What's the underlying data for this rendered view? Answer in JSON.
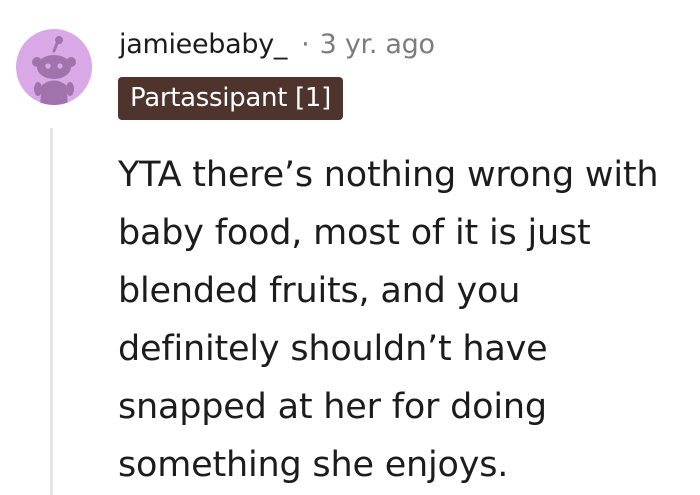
{
  "comment": {
    "avatar_icon": "reddit-snoo-avatar-icon",
    "avatar_bg_color": "#d9a8e6",
    "username": "jamieebaby_",
    "separator": "·",
    "timestamp": "3 yr. ago",
    "flair": {
      "label": "Partassipant [1]",
      "bg_color": "#4e342c",
      "text_color": "#ffffff"
    },
    "body_lines": [
      "YTA there’s nothing wrong with",
      "baby food, most of it is just",
      "blended fruits, and you",
      "definitely shouldn’t have",
      "snapped at her for doing",
      "something she enjoys."
    ]
  }
}
